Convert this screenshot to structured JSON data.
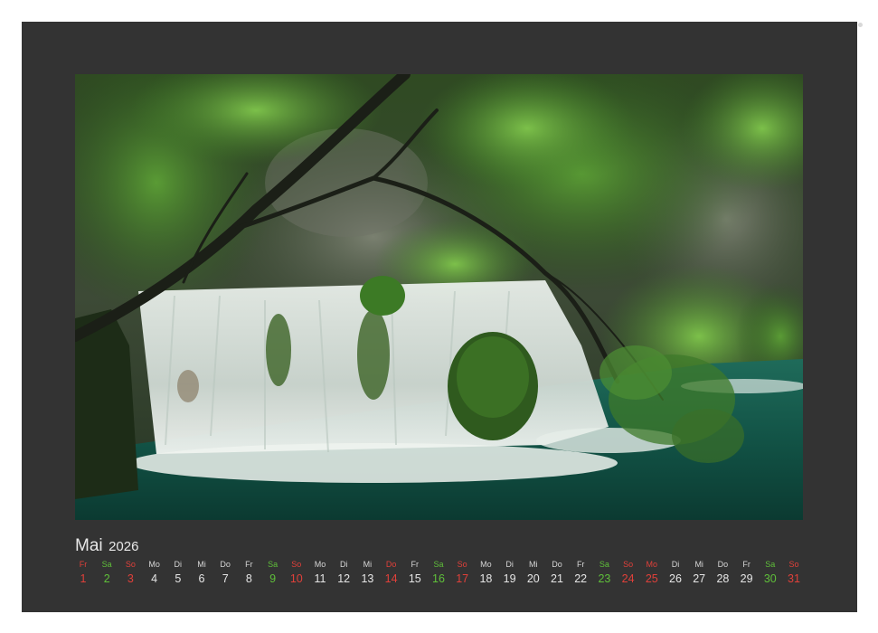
{
  "calendar": {
    "month": "Mai",
    "year": "2026",
    "days": [
      {
        "wd": "Fr",
        "d": "1",
        "type": "holiday"
      },
      {
        "wd": "Sa",
        "d": "2",
        "type": "sat"
      },
      {
        "wd": "So",
        "d": "3",
        "type": "sun"
      },
      {
        "wd": "Mo",
        "d": "4",
        "type": "work"
      },
      {
        "wd": "Di",
        "d": "5",
        "type": "work"
      },
      {
        "wd": "Mi",
        "d": "6",
        "type": "work"
      },
      {
        "wd": "Do",
        "d": "7",
        "type": "work"
      },
      {
        "wd": "Fr",
        "d": "8",
        "type": "work"
      },
      {
        "wd": "Sa",
        "d": "9",
        "type": "sat"
      },
      {
        "wd": "So",
        "d": "10",
        "type": "sun"
      },
      {
        "wd": "Mo",
        "d": "11",
        "type": "work"
      },
      {
        "wd": "Di",
        "d": "12",
        "type": "work"
      },
      {
        "wd": "Mi",
        "d": "13",
        "type": "work"
      },
      {
        "wd": "Do",
        "d": "14",
        "type": "holiday"
      },
      {
        "wd": "Fr",
        "d": "15",
        "type": "work"
      },
      {
        "wd": "Sa",
        "d": "16",
        "type": "sat"
      },
      {
        "wd": "So",
        "d": "17",
        "type": "sun"
      },
      {
        "wd": "Mo",
        "d": "18",
        "type": "work"
      },
      {
        "wd": "Di",
        "d": "19",
        "type": "work"
      },
      {
        "wd": "Mi",
        "d": "20",
        "type": "work"
      },
      {
        "wd": "Do",
        "d": "21",
        "type": "work"
      },
      {
        "wd": "Fr",
        "d": "22",
        "type": "work"
      },
      {
        "wd": "Sa",
        "d": "23",
        "type": "sat"
      },
      {
        "wd": "So",
        "d": "24",
        "type": "sun"
      },
      {
        "wd": "Mo",
        "d": "25",
        "type": "holiday"
      },
      {
        "wd": "Di",
        "d": "26",
        "type": "work"
      },
      {
        "wd": "Mi",
        "d": "27",
        "type": "work"
      },
      {
        "wd": "Do",
        "d": "28",
        "type": "work"
      },
      {
        "wd": "Fr",
        "d": "29",
        "type": "work"
      },
      {
        "wd": "Sa",
        "d": "30",
        "type": "sat"
      },
      {
        "wd": "So",
        "d": "31",
        "type": "sun"
      }
    ]
  },
  "colors": {
    "page_background": "#333333",
    "weekday_text": "#e6e6e6",
    "saturday": "#5fbf3a",
    "sunday_holiday": "#e0403a"
  },
  "photo": {
    "icons": [
      "waterfall-photo"
    ]
  }
}
